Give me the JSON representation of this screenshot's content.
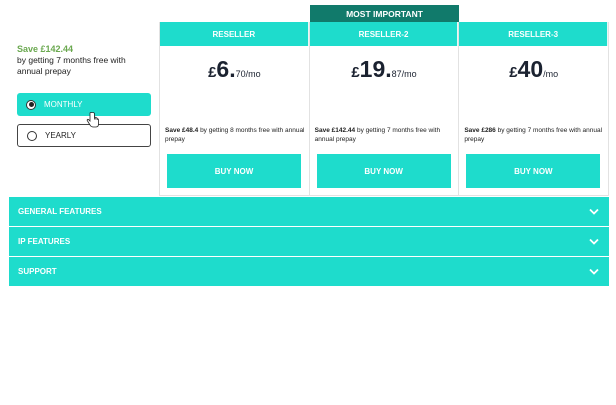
{
  "sidebar": {
    "save_headline": "Save £142.44",
    "save_sub": "by getting 7 months free with annual prepay",
    "periods": [
      {
        "label": "MONTHLY",
        "selected": true
      },
      {
        "label": "YEARLY",
        "selected": false
      }
    ]
  },
  "badge": "MOST IMPORTANT",
  "plans": [
    {
      "name": "RESELLER",
      "currency": "£",
      "price_main": "6.",
      "price_sub": "70/mo",
      "save_amount": "Save £48.4",
      "save_text": " by getting 8 months free with annual prepay",
      "button": "BUY NOW"
    },
    {
      "name": "RESELLER-2",
      "currency": "£",
      "price_main": "19.",
      "price_sub": "87/mo",
      "save_amount": "Save £142.44",
      "save_text": " by getting 7 months free with annual prepay",
      "button": "BUY NOW"
    },
    {
      "name": "RESELLER-3",
      "currency": "£",
      "price_main": "40",
      "price_sub": "/mo",
      "save_amount": "Save £286",
      "save_text": " by getting 7 months free with annual prepay",
      "button": "BUY NOW"
    }
  ],
  "accordion": [
    {
      "label": "GENERAL FEATURES"
    },
    {
      "label": "IP FEATURES"
    },
    {
      "label": "SUPPORT"
    }
  ],
  "colors": {
    "accent": "#1edccc",
    "badge": "#117a6b",
    "save_green": "#6aa84f"
  }
}
